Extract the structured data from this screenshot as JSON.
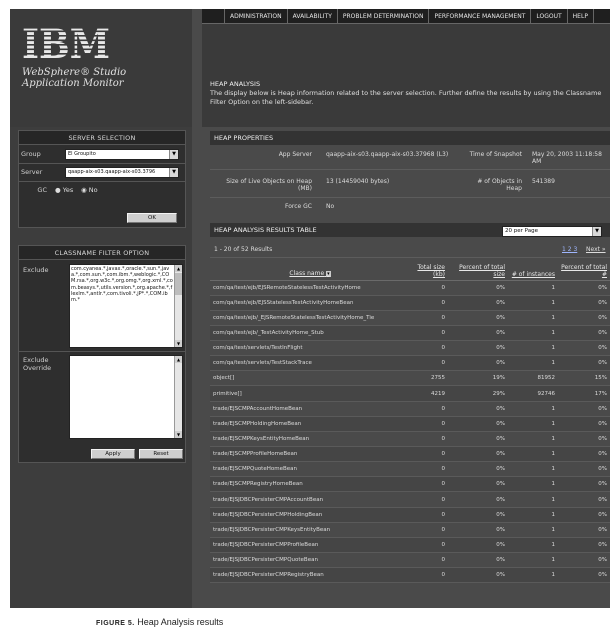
{
  "logo": {
    "text": "IBM"
  },
  "product": {
    "line1": "WebSphere® Studio",
    "line2": "Application Monitor"
  },
  "nav": [
    "ADMINISTRATION",
    "AVAILABILITY",
    "PROBLEM DETERMINATION",
    "PERFORMANCE MANAGEMENT",
    "LOGOUT",
    "HELP"
  ],
  "header": {
    "title": "HEAP ANALYSIS",
    "description": "The display below is Heap information related to the server selection. Further define the results by using the Classname Filter Option on the left-sidebar."
  },
  "server_selection": {
    "title": "SERVER SELECTION",
    "group_label": "Group",
    "group_value": "El Groupito",
    "server_label": "Server",
    "server_value": "qaapp-aix-s03.qaapp-aix-s03.3796",
    "gc_label": "GC",
    "gc_yes": "Yes",
    "gc_no": "No",
    "gc_selected": "No",
    "ok_label": "OK"
  },
  "filter": {
    "title": "CLASSNAME FILTER OPTION",
    "exclude_label": "Exclude",
    "exclude_value": "com.cyanea.*,javax.*,oracle.*,sun.*,java.*,com.sun.*,com.ibm.*,weblogic.*,COM.rsa.*,org.w3c.*,org.omg.*,org.xml.*,com.beasys.*,utils.version.*,org.apache.*,flexlm.*,antlr.*,com.tivoli.*,jP*.*,COM.ibm.*",
    "override_label": "Exclude Override",
    "override_value": "",
    "apply_label": "Apply",
    "reset_label": "Reset"
  },
  "heap_properties": {
    "title": "HEAP PROPERTIES",
    "app_server_label": "App Server",
    "app_server_value": "qaapp-aix-s03.qaapp-aix-s03.37968 (L3)",
    "snapshot_label": "Time of Snapshot",
    "snapshot_value": "May 20, 2003 11:18:58 AM",
    "live_size_label": "Size of Live Objects on Heap (MB)",
    "live_size_value": "13 (14459040 bytes)",
    "objects_label": "# of Objects in Heap",
    "objects_value": "541389",
    "force_gc_label": "Force GC",
    "force_gc_value": "No"
  },
  "results": {
    "title": "HEAP ANALYSIS RESULTS TABLE",
    "per_page": "20 per Page",
    "range_text": "1 - 20 of 52 Results",
    "pages": "1 2 3",
    "next_label": "Next »",
    "columns": [
      "Class name",
      "Total size (kb)",
      "Percent of total size",
      "# of instances",
      "Percent of total #"
    ],
    "rows": [
      [
        "com/qa/test/ejb/EJSRemoteStatelessTestActivityHome",
        "0",
        "0%",
        "1",
        "0%"
      ],
      [
        "com/qa/test/ejb/EJSStatelessTestActivityHomeBean",
        "0",
        "0%",
        "1",
        "0%"
      ],
      [
        "com/qa/test/ejb/_EJSRemoteStatelessTestActivityHome_Tie",
        "0",
        "0%",
        "1",
        "0%"
      ],
      [
        "com/qa/test/ejb/_TestActivityHome_Stub",
        "0",
        "0%",
        "1",
        "0%"
      ],
      [
        "com/qa/test/servlets/TestInFlight",
        "0",
        "0%",
        "1",
        "0%"
      ],
      [
        "com/qa/test/servlets/TestStackTrace",
        "0",
        "0%",
        "1",
        "0%"
      ],
      [
        "object[]",
        "2755",
        "19%",
        "81952",
        "15%"
      ],
      [
        "primitive[]",
        "4219",
        "29%",
        "92746",
        "17%"
      ],
      [
        "trade/EJSCMPAccountHomeBean",
        "0",
        "0%",
        "1",
        "0%"
      ],
      [
        "trade/EJSCMPHoldingHomeBean",
        "0",
        "0%",
        "1",
        "0%"
      ],
      [
        "trade/EJSCMPKeysEntityHomeBean",
        "0",
        "0%",
        "1",
        "0%"
      ],
      [
        "trade/EJSCMPProfileHomeBean",
        "0",
        "0%",
        "1",
        "0%"
      ],
      [
        "trade/EJSCMPQuoteHomeBean",
        "0",
        "0%",
        "1",
        "0%"
      ],
      [
        "trade/EJSCMPRegistryHomeBean",
        "0",
        "0%",
        "1",
        "0%"
      ],
      [
        "trade/EJSJDBCPersisterCMPAccountBean",
        "0",
        "0%",
        "1",
        "0%"
      ],
      [
        "trade/EJSJDBCPersisterCMPHoldingBean",
        "0",
        "0%",
        "1",
        "0%"
      ],
      [
        "trade/EJSJDBCPersisterCMPKeysEntityBean",
        "0",
        "0%",
        "1",
        "0%"
      ],
      [
        "trade/EJSJDBCPersisterCMPProfileBean",
        "0",
        "0%",
        "1",
        "0%"
      ],
      [
        "trade/EJSJDBCPersisterCMPQuoteBean",
        "0",
        "0%",
        "1",
        "0%"
      ],
      [
        "trade/EJSJDBCPersisterCMPRegistryBean",
        "0",
        "0%",
        "1",
        "0%"
      ]
    ]
  },
  "caption": {
    "label": "FIGURE 5.",
    "text": "Heap Analysis results"
  }
}
